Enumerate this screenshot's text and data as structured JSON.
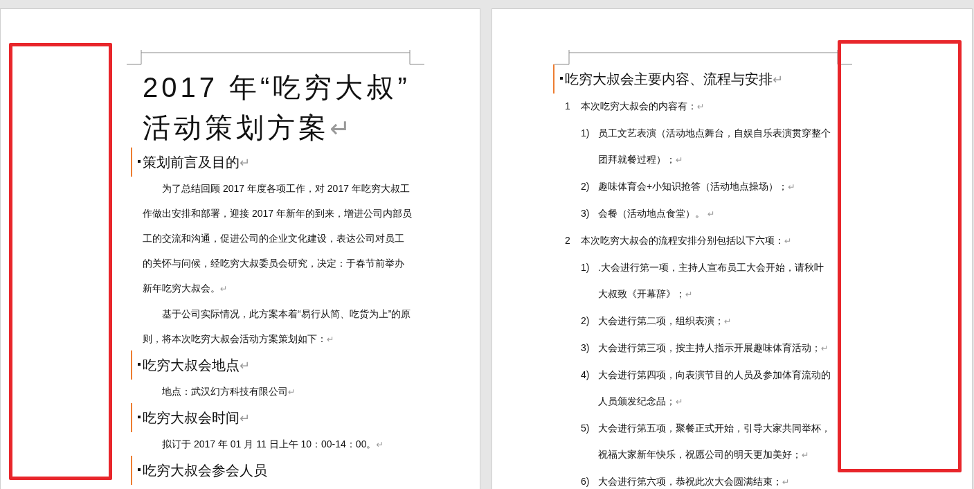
{
  "paragraph_mark": "↵",
  "pages": [
    {
      "blocks": [
        {
          "kind": "title",
          "text": "2017 年“吃穷大叔”\n活动策划方案",
          "marked": true
        },
        {
          "kind": "heading",
          "text": "策划前言及目的",
          "marked": true
        },
        {
          "kind": "body",
          "text": "为了总结回顾 2017 年度各项工作，对 2017 年吃穷大叔工作做出安排和部署，迎接 2017 年新年的到来，增进公司内部员工的交流和沟通，促进公司的企业文化建设，表达公司对员工的关怀与问候，经吃穷大叔委员会研究，决定：于春节前举办新年吃穷大叔会。",
          "marked": true
        },
        {
          "kind": "body",
          "text": "基于公司实际情况，此方案本着“易行从简、吃货为上”的原则，将本次吃穷大叔会活动方案策划如下：",
          "marked": true
        },
        {
          "kind": "heading",
          "text": "吃穷大叔会地点",
          "marked": true
        },
        {
          "kind": "body",
          "text": "地点：武汉幻方科技有限公司",
          "marked": true
        },
        {
          "kind": "heading",
          "text": "吃穷大叔会时间",
          "marked": true
        },
        {
          "kind": "body",
          "text": "拟订于 2017 年 01 月 11 日上午 10：00-14：00。",
          "marked": true
        },
        {
          "kind": "heading",
          "text": "吃穷大叔会参会人员",
          "marked": false
        }
      ]
    },
    {
      "blocks": [
        {
          "kind": "heading",
          "text": "吃穷大叔会主要内容、流程与安排",
          "marked": true
        },
        {
          "kind": "item",
          "number": "1",
          "text": "本次吃穷大叔会的内容有：",
          "marked": true
        },
        {
          "kind": "subitem",
          "number": "1)",
          "text": "员工文艺表演（活动地点舞台，自娱自乐表演贯穿整个团拜就餐过程）；",
          "marked": true
        },
        {
          "kind": "subitem",
          "number": "2)",
          "text": "趣味体育会+小知识抢答（活动地点操场）；",
          "marked": true
        },
        {
          "kind": "subitem",
          "number": "3)",
          "text": "会餐（活动地点食堂）。 ",
          "marked": true
        },
        {
          "kind": "item",
          "number": "2",
          "text": "本次吃穷大叔会的流程安排分别包括以下六项：",
          "marked": true
        },
        {
          "kind": "subitem",
          "number": "1)",
          "text": ".大会进行第一项，主持人宣布员工大会开始，请秋叶大叔致《开幕辞》；",
          "marked": true
        },
        {
          "kind": "subitem",
          "number": "2)",
          "text": "大会进行第二项，组织表演；",
          "marked": true
        },
        {
          "kind": "subitem",
          "number": "3)",
          "text": "大会进行第三项，按主持人指示开展趣味体育活动；",
          "marked": true
        },
        {
          "kind": "subitem",
          "number": "4)",
          "text": "大会进行第四项，向表演节目的人员及参加体育流动的人员颁发纪念品；",
          "marked": true
        },
        {
          "kind": "subitem",
          "number": "5)",
          "text": "大会进行第五项，聚餐正式开始，引导大家共同举杯，祝福大家新年快乐，祝愿公司的明天更加美好；",
          "marked": true
        },
        {
          "kind": "subitem",
          "number": "6)",
          "text": "大会进行第六项，恭祝此次大会圆满结束；",
          "marked": true
        }
      ]
    }
  ]
}
